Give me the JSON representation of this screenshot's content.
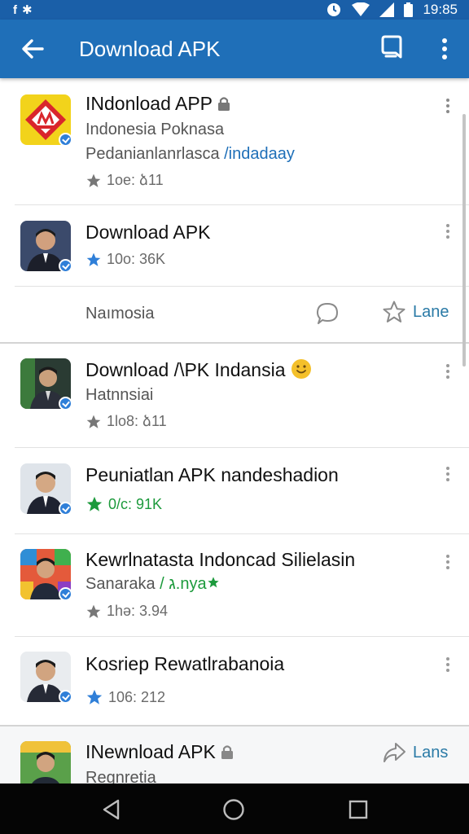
{
  "status_bar": {
    "left_icons": [
      "facebook-icon",
      "notification-icon"
    ],
    "right_icons": [
      "clock-icon",
      "wifi-icon",
      "signal-icon",
      "battery-icon"
    ],
    "time": "19:85"
  },
  "app_bar": {
    "title": "Download APK",
    "icons": [
      "back-arrow-icon",
      "bookmark-icon",
      "more-vert-icon"
    ],
    "color": "#1f6fb8"
  },
  "items": [
    {
      "title": "INdonload APP",
      "subtitle": "Indonesia Poknasa",
      "line3_a": "Pedanianlanrlasca ",
      "line3_b": "/indadaay",
      "meta": "1oe: ձ11"
    },
    {
      "title": "Download APK",
      "meta": "10o: 36K"
    },
    {
      "title": "Download /\\PK Indansia",
      "subtitle": "Hatnnsiai",
      "meta": "1lo8: ձ11"
    },
    {
      "title": "Peuniatlan APK nandeshadion",
      "meta": "0/c: 91K"
    },
    {
      "title": "Kewrlnatasta Indoncad Silielasin",
      "subtitle_a": "Sanaraka ",
      "subtitle_b": "/ ג.nya",
      "meta": "1hə: 3.94"
    },
    {
      "title": "Kosriep Rewatlrabanoia",
      "meta": "106: 212"
    },
    {
      "title": "INewnload APK",
      "subtitle": "Regnretia",
      "action": "Lans"
    }
  ],
  "action_row": {
    "label": "Naımosia",
    "action": "Lane"
  },
  "colors": {
    "accent": "#1f6fb8",
    "link": "#1e6fb8",
    "green": "#1c9a3c",
    "star_blue": "#2f7fd8"
  }
}
